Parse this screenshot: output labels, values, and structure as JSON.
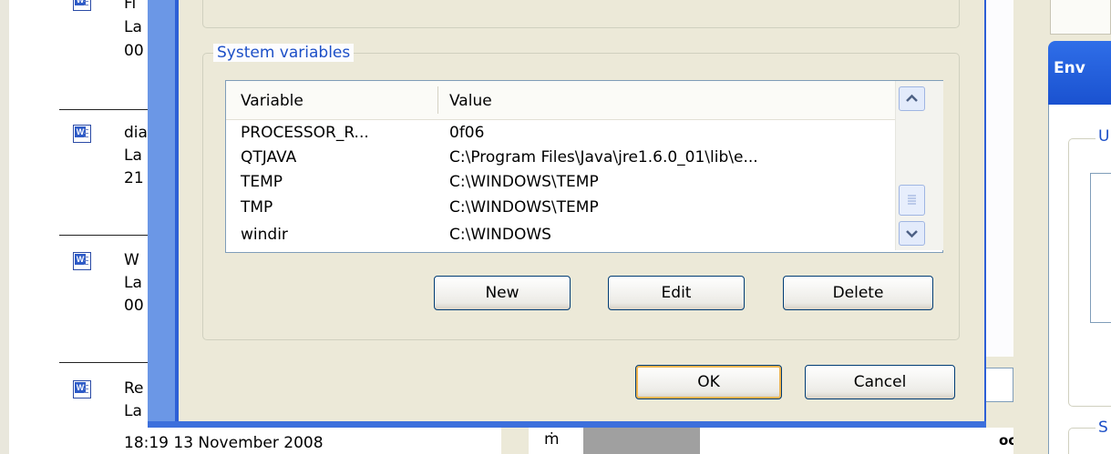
{
  "left_list": {
    "items": [
      {
        "name": "Fi",
        "line2": "La",
        "line3": "00"
      },
      {
        "name": "dia",
        "line2": "La",
        "line3": "21"
      },
      {
        "name": "W",
        "line2": "La",
        "line3": "00"
      },
      {
        "name": "Re",
        "line2": "La",
        "line3": ""
      }
    ],
    "bottom_text": "18:19 13 November 2008"
  },
  "dialog": {
    "group_label": "System variables",
    "columns": [
      "Variable",
      "Value"
    ],
    "rows": [
      {
        "variable": "PROCESSOR_R...",
        "value": "0f06"
      },
      {
        "variable": "QTJAVA",
        "value": "C:\\Program Files\\Java\\jre1.6.0_01\\lib\\e..."
      },
      {
        "variable": "TEMP",
        "value": "C:\\WINDOWS\\TEMP"
      },
      {
        "variable": "TMP",
        "value": "C:\\WINDOWS\\TEMP"
      },
      {
        "variable": "windir",
        "value": "C:\\WINDOWS"
      }
    ],
    "buttons": {
      "new": "New",
      "edit": "Edit",
      "delete": "Delete",
      "ok": "OK",
      "cancel": "Cancel"
    }
  },
  "background": {
    "bottom_char": "ṁ",
    "bottom_right_text": "oc"
  },
  "right_window": {
    "title": "Env",
    "group1_label": "U",
    "group2_label": "S"
  },
  "icons": {
    "scroll_up": "chevron-up-icon",
    "scroll_down": "chevron-down-icon",
    "doc": "word-document-icon"
  },
  "colors": {
    "accent": "#1c4fc7",
    "frame": "#3c6fdc",
    "dialog_bg": "#ece9d8"
  }
}
